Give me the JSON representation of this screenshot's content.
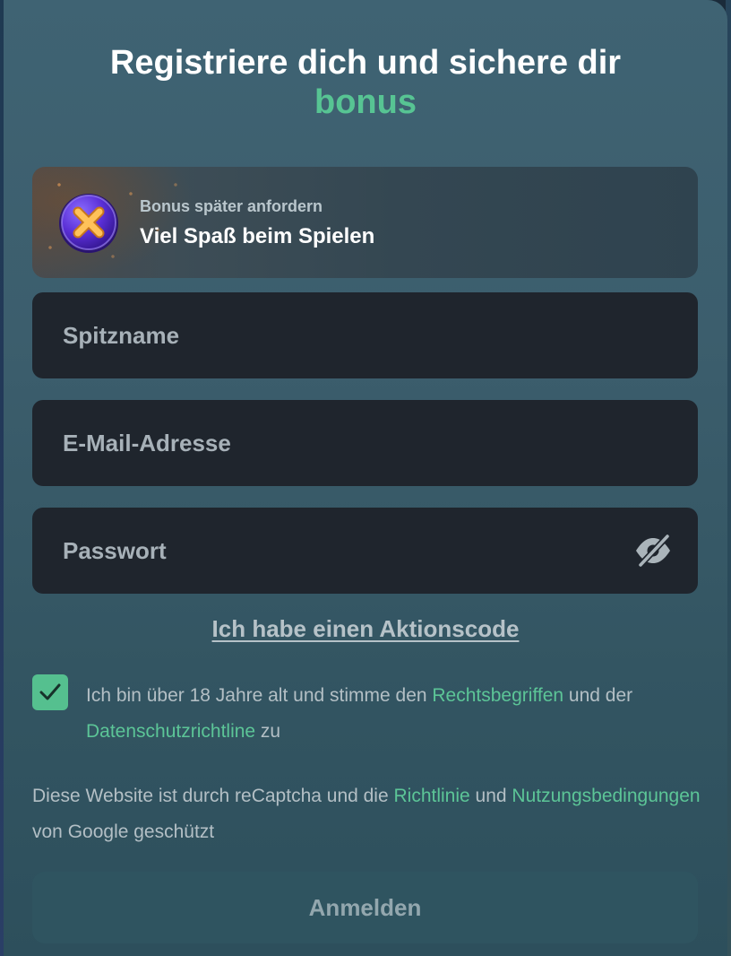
{
  "modal": {
    "title_line1": "Registriere dich und sichere dir",
    "title_accent": "bonus",
    "accent_color": "#57c493"
  },
  "bonus_card": {
    "subtitle": "Bonus später anfordern",
    "main": "Viel Spaß beim Spielen",
    "icon": "close-coin-icon"
  },
  "form": {
    "nickname_placeholder": "Spitzname",
    "email_placeholder": "E-Mail-Adresse",
    "password_placeholder": "Passwort",
    "password_toggle_icon": "eye-slash-icon",
    "promo_link": "Ich habe einen Aktionscode"
  },
  "consent": {
    "checked": true,
    "text_before": "Ich bin über 18 Jahre alt und stimme den ",
    "terms_link": "Rechtsbegriffen",
    "text_middle": " und der ",
    "privacy_link": "Datenschutzrichtline",
    "text_after": " zu"
  },
  "recaptcha": {
    "text_before": "Diese Website ist durch reCaptcha und die ",
    "policy_link": "Richtlinie",
    "text_middle": " und ",
    "terms_link": "Nutzungsbedingungen",
    "text_after": " von Google geschützt"
  },
  "submit_label": "Anmelden"
}
